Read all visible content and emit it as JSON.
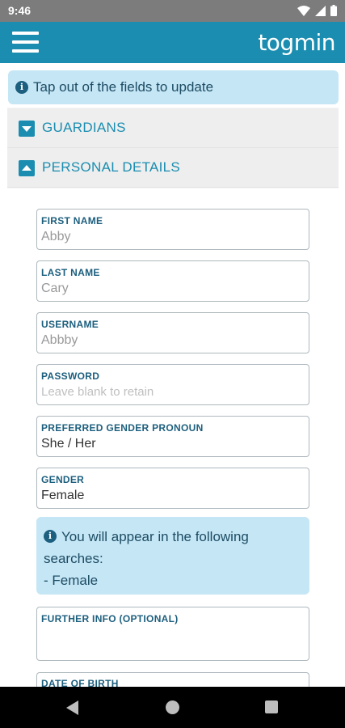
{
  "status_bar": {
    "time": "9:46",
    "icons": [
      "wifi-icon",
      "signal-icon",
      "battery-icon"
    ]
  },
  "app_bar": {
    "logo": "togmin",
    "menu_icon": "hamburger-menu-icon",
    "color": "#1a8db0"
  },
  "info_banner": {
    "icon": "info-icon",
    "text": "Tap out of the fields to update"
  },
  "sections": {
    "guardians": {
      "label": "GUARDIANS",
      "expanded": false
    },
    "personal_details": {
      "label": "PERSONAL DETAILS",
      "expanded": true
    }
  },
  "fields": {
    "first_name": {
      "label": "FIRST NAME",
      "value": "Abby"
    },
    "last_name": {
      "label": "LAST NAME",
      "value": "Cary"
    },
    "username": {
      "label": "USERNAME",
      "value": "Abbby"
    },
    "password": {
      "label": "PASSWORD",
      "placeholder": "Leave blank to retain"
    },
    "pronoun": {
      "label": "PREFERRED GENDER PRONOUN",
      "value": "She / Her"
    },
    "gender": {
      "label": "GENDER",
      "value": "Female"
    },
    "further_info": {
      "label": "FURTHER INFO (OPTIONAL)",
      "value": ""
    },
    "dob": {
      "label": "DATE OF BIRTH"
    }
  },
  "search_note": {
    "icon": "info-icon",
    "line1": "You will appear in the following",
    "line2": "searches:",
    "line3": "- Female"
  },
  "nav_bar": {
    "icons": [
      "back-icon",
      "home-icon",
      "recents-icon"
    ]
  }
}
